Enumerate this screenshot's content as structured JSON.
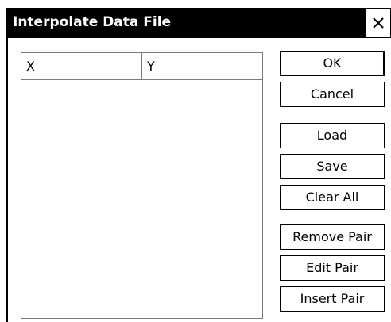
{
  "window": {
    "title": "Interpolate Data File",
    "close_icon": "close-icon"
  },
  "table": {
    "columns": [
      "X",
      "Y"
    ],
    "rows": []
  },
  "buttons": {
    "ok": "OK",
    "cancel": "Cancel",
    "load": "Load",
    "save": "Save",
    "clear_all": "Clear All",
    "remove_pair": "Remove Pair",
    "edit_pair": "Edit Pair",
    "insert_pair": "Insert Pair"
  }
}
